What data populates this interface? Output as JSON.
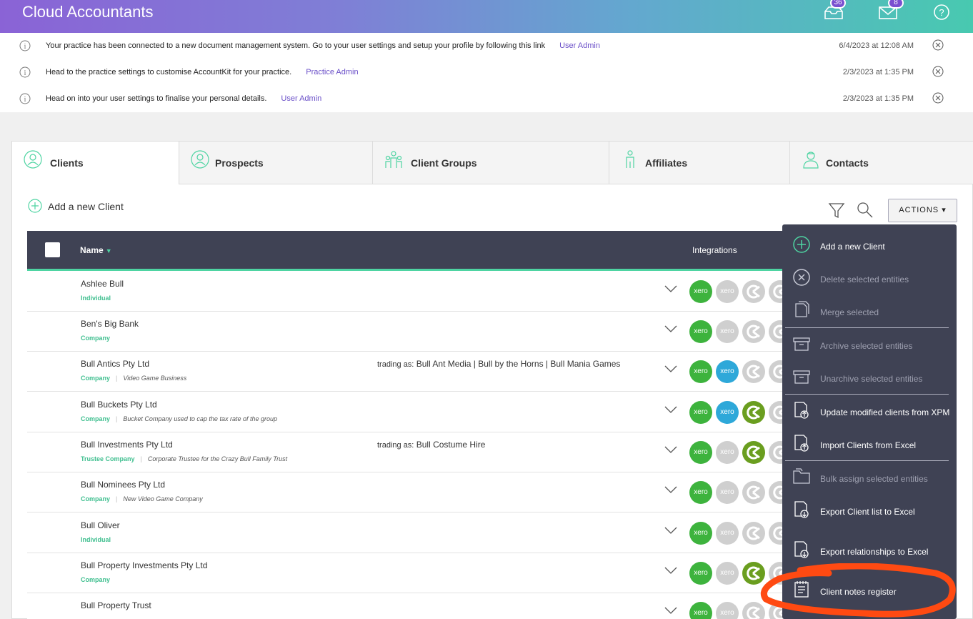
{
  "app": {
    "title": "Cloud Accountants"
  },
  "header": {
    "inbox_count": "36",
    "mail_count": "8"
  },
  "notifications": [
    {
      "message": "Your practice has been connected to a new document management system. Go to your user settings and setup your profile by following this link",
      "link": "User Admin",
      "date": "6/4/2023 at 12:08 AM"
    },
    {
      "message": "Head to the practice settings to customise AccountKit for your practice.",
      "link": "Practice Admin",
      "date": "2/3/2023 at 1:35 PM"
    },
    {
      "message": "Head on into your user settings to finalise your personal details.",
      "link": "User Admin",
      "date": "2/3/2023 at 1:35 PM"
    }
  ],
  "tabs": [
    {
      "label": "Clients"
    },
    {
      "label": "Prospects"
    },
    {
      "label": "Client Groups"
    },
    {
      "label": "Affiliates"
    },
    {
      "label": "Contacts"
    }
  ],
  "toolbar": {
    "add_label": "Add a new Client",
    "actions_label": "ACTIONS ▾"
  },
  "table": {
    "col_name": "Name",
    "col_integrations": "Integrations",
    "rows": [
      {
        "name": "Ashlee Bull",
        "type": "Individual",
        "desc": "",
        "trading": ""
      },
      {
        "name": "Ben's Big Bank",
        "type": "Company",
        "desc": "",
        "trading": ""
      },
      {
        "name": "Bull Antics Pty Ltd",
        "type": "Company",
        "desc": "Video Game Business",
        "trading": "Bull Ant Media | Bull by the Horns | Bull Mania Games"
      },
      {
        "name": "Bull Buckets Pty Ltd",
        "type": "Company",
        "desc": "Bucket Company used to cap the tax rate of the group",
        "trading": ""
      },
      {
        "name": "Bull Investments Pty Ltd",
        "type": "Trustee Company",
        "desc": "Corporate Trustee for the Crazy Bull Family Trust",
        "trading": "Bull Costume Hire"
      },
      {
        "name": "Bull Nominees Pty Ltd",
        "type": "Company",
        "desc": "New Video Game Company",
        "trading": ""
      },
      {
        "name": "Bull Oliver",
        "type": "Individual",
        "desc": "",
        "trading": ""
      },
      {
        "name": "Bull Property Investments Pty Ltd",
        "type": "Company",
        "desc": "",
        "trading": ""
      },
      {
        "name": "Bull Property Trust",
        "type": "",
        "desc": "",
        "trading": ""
      }
    ],
    "trading_prefix": "trading as:",
    "xero_label": "xero"
  },
  "menu": {
    "items": [
      {
        "label": "Add a new Client",
        "icon": "plus-circle-icon",
        "enabled": true
      },
      {
        "label": "Delete selected entities",
        "icon": "x-circle-icon",
        "enabled": false
      },
      {
        "label": "Merge selected",
        "icon": "copy-icon",
        "enabled": false
      },
      {
        "label": "Archive selected entities",
        "icon": "archive-icon",
        "enabled": false
      },
      {
        "label": "Unarchive selected entities",
        "icon": "archive-icon",
        "enabled": false
      },
      {
        "label": "Update modified clients from XPM",
        "icon": "file-upload-icon",
        "enabled": true
      },
      {
        "label": "Import Clients from Excel",
        "icon": "file-upload-icon",
        "enabled": true
      },
      {
        "label": "Bulk assign selected entities",
        "icon": "folder-icon",
        "enabled": false
      },
      {
        "label": "Export Client list to Excel",
        "icon": "file-download-icon",
        "enabled": true
      },
      {
        "label": "Export relationships to Excel",
        "icon": "file-download-icon",
        "enabled": true
      },
      {
        "label": "Client notes register",
        "icon": "notes-icon",
        "enabled": true
      }
    ]
  },
  "colors": {
    "accent": "#4ed4a2",
    "header_dark": "#3f4254",
    "xero_green": "#3db33d",
    "xero_blue": "#2ea8d9",
    "xpm_green": "#6a9e1f",
    "inactive": "#cfcfcf",
    "highlight": "#ff4a12"
  }
}
